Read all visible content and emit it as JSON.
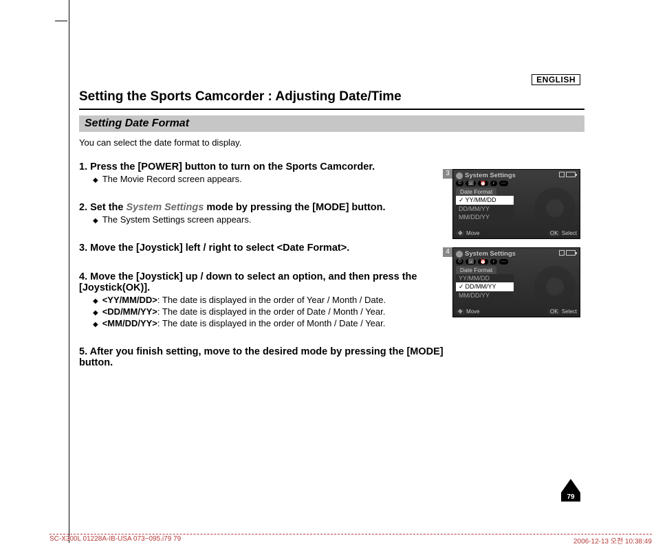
{
  "language_label": "ENGLISH",
  "page_title": "Setting the Sports Camcorder : Adjusting Date/Time",
  "section_title": "Setting Date Format",
  "intro": "You can select the date format to display.",
  "steps": [
    {
      "num": "1.",
      "title": "Press the [POWER] button to turn on the Sports Camcorder.",
      "subs": [
        "The Movie Record screen appears."
      ]
    },
    {
      "num": "2.",
      "title_pre": "Set the ",
      "title_it": "System Settings",
      "title_post": " mode by pressing the [MODE] button.",
      "subs": [
        "The System Settings screen appears."
      ]
    },
    {
      "num": "3.",
      "title": "Move the [Joystick] left / right to select <Date Format>.",
      "subs": []
    },
    {
      "num": "4.",
      "title": "Move the [Joystick] up / down to select an option, and then press the [Joystick(OK)].",
      "opts": [
        {
          "tag": "<YY/MM/DD>",
          "desc": ": The date is displayed in the order of Year / Month / Date."
        },
        {
          "tag": "<DD/MM/YY>",
          "desc": ": The date is displayed in the order of Date / Month / Year."
        },
        {
          "tag": "<MM/DD/YY>",
          "desc": ": The date is displayed in the order of Month / Date / Year."
        }
      ]
    },
    {
      "num": "5.",
      "title": "After you finish setting, move to the desired mode by pressing the [MODE] button.",
      "subs": []
    }
  ],
  "screenshots": {
    "header_label": "System Settings",
    "tab_label": "Date Format",
    "options": [
      "YY/MM/DD",
      "DD/MM/YY",
      "MM/DD/YY"
    ],
    "foot_move": "Move",
    "foot_select": "Select",
    "foot_ok": "OK",
    "shot3_num": "3",
    "shot3_selected": "YY/MM/DD",
    "shot4_num": "4",
    "shot4_selected": "DD/MM/YY"
  },
  "page_number": "79",
  "footer": {
    "left": "SC-X300L 01228A-IB-USA 073~095.i79   79",
    "right": "2006-12-13   오전 10:38:49"
  }
}
